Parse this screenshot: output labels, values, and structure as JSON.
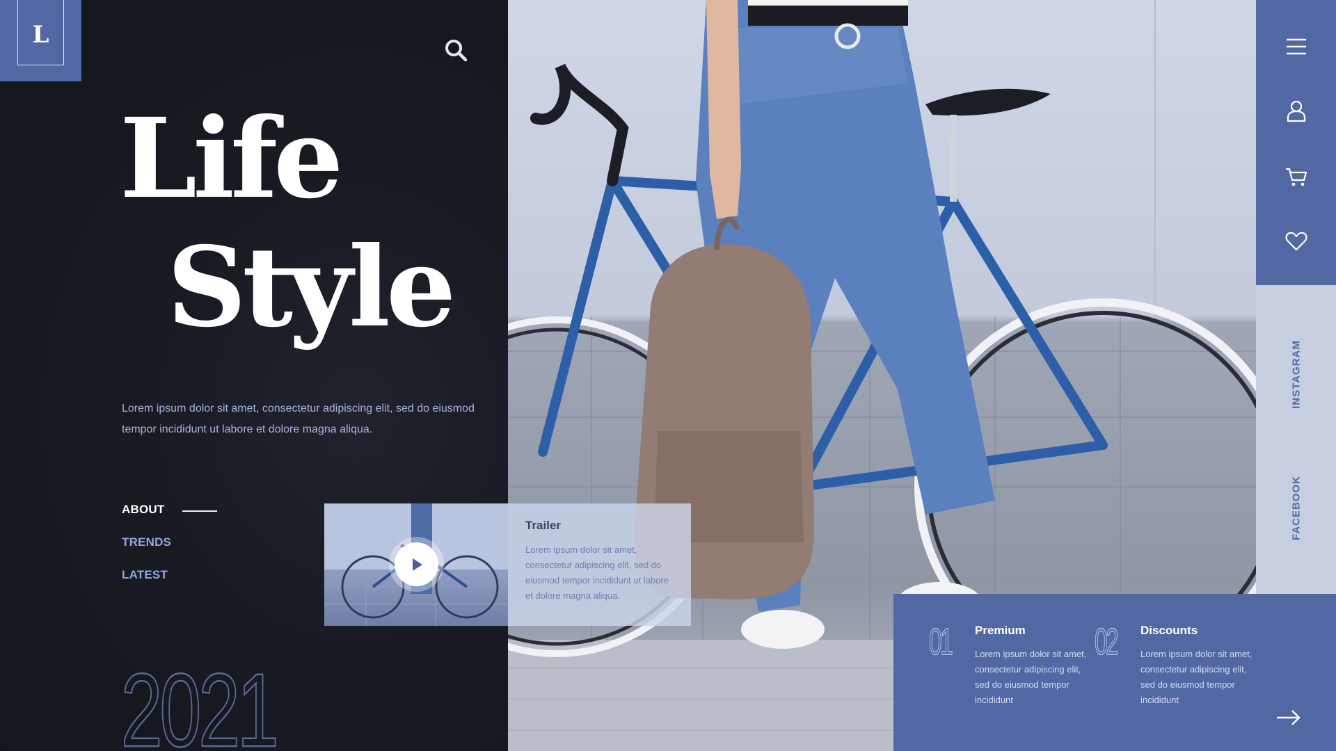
{
  "brand": {
    "logo_letter": "L"
  },
  "hero": {
    "title_line1": "Life",
    "title_line2": "Style",
    "intro": "Lorem ipsum dolor sit amet, consectetur adipiscing elit, sed do eiusmod tempor incididunt ut labore et dolore magna aliqua."
  },
  "nav": [
    {
      "label": "ABOUT",
      "active": true
    },
    {
      "label": "TRENDS",
      "active": false
    },
    {
      "label": "LATEST",
      "active": false
    }
  ],
  "year": "2021",
  "trailer": {
    "title": "Trailer",
    "text": "Lorem ipsum dolor sit amet, consectetur adipiscing elit, sed do eiusmod tempor incididunt ut labore et dolore magna aliqua."
  },
  "sidebar": {
    "icons": [
      "menu-icon",
      "user-icon",
      "cart-icon",
      "heart-icon"
    ],
    "social": [
      "INSTAGRAM",
      "FACEBOOK"
    ]
  },
  "features": [
    {
      "number": "01",
      "title": "Premium",
      "text": "Lorem ipsum dolor sit amet, consectetur adipiscing elit, sed do eiusmod tempor incididunt"
    },
    {
      "number": "02",
      "title": "Discounts",
      "text": "Lorem ipsum dolor sit amet, consectetur adipiscing elit, sed do eiusmod tempor incididunt"
    }
  ],
  "colors": {
    "accent": "#5168a3",
    "dark": "#181a22",
    "light_panel": "#c7cedf"
  }
}
